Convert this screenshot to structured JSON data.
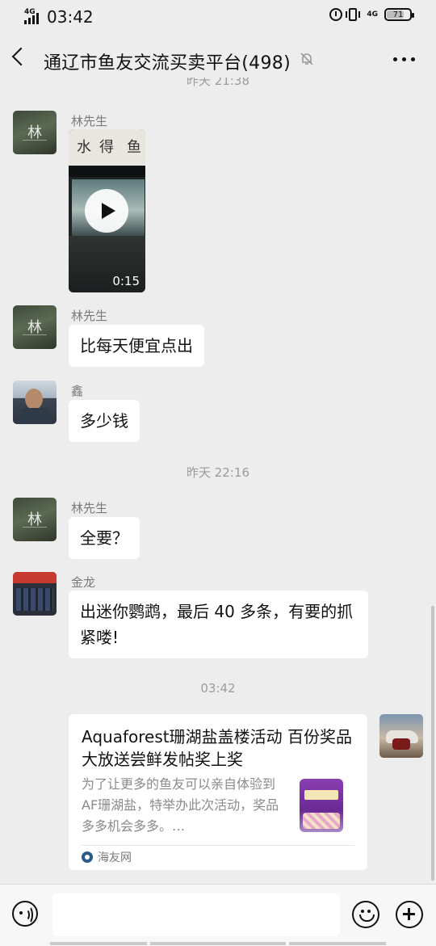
{
  "status_bar": {
    "network_left": "4G",
    "time": "03:42",
    "network_right": "4G",
    "battery_level": "71",
    "icons": [
      "signal-icon",
      "alarm-icon",
      "vibrate-icon",
      "battery-icon"
    ]
  },
  "header": {
    "title": "通辽市鱼友交流买卖平台(498)",
    "icons": [
      "back-icon",
      "mute-icon",
      "more-icon"
    ]
  },
  "timestamps": {
    "top_cut": "昨天 21:38",
    "mid": "昨天 22:16",
    "latest": "03:42"
  },
  "messages": [
    {
      "sender": "林先生",
      "type": "video",
      "duration": "0:15",
      "calligraphy": "水得鱼"
    },
    {
      "sender": "林先生",
      "type": "text",
      "text": "比每天便宜点出"
    },
    {
      "sender": "鑫",
      "type": "text",
      "text": "多少钱"
    },
    {
      "sender": "林先生",
      "type": "text",
      "text": "全要？"
    },
    {
      "sender": "金龙",
      "type": "text",
      "text": "出迷你鹦鹉，最后 40 多条，有要的抓紧喽!"
    }
  ],
  "link_card": {
    "title": "Aquaforest珊湖盐盖楼活动 百份奖品大放送尝鲜发帖奖上奖",
    "description": "为了让更多的鱼友可以亲自体验到AF珊湖盐，特举办此次活动，奖品多多机会多多。…",
    "source": "海友网"
  },
  "input_bar": {
    "placeholder": "",
    "icons": [
      "voice-icon",
      "emoji-icon",
      "plus-icon"
    ]
  },
  "colors": {
    "background": "#ededed",
    "bubble": "#ffffff",
    "timestamp": "#9b9b9b",
    "name": "#7a7a7a"
  }
}
